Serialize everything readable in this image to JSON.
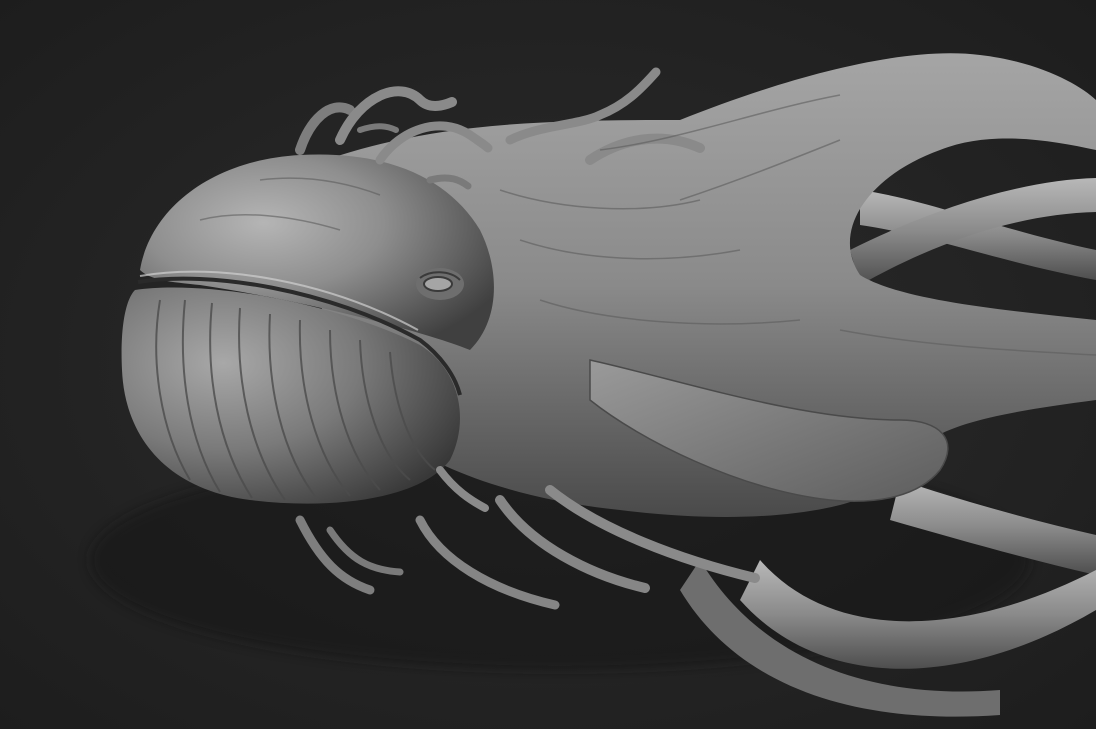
{
  "scene": {
    "subject": "whale-tentacle-creature",
    "material": "matcap-grey",
    "background_color": "#232323",
    "body_color": "#8c8c8c",
    "highlight_color": "#c8c8c8",
    "shadow_color": "#3a3a3a"
  }
}
